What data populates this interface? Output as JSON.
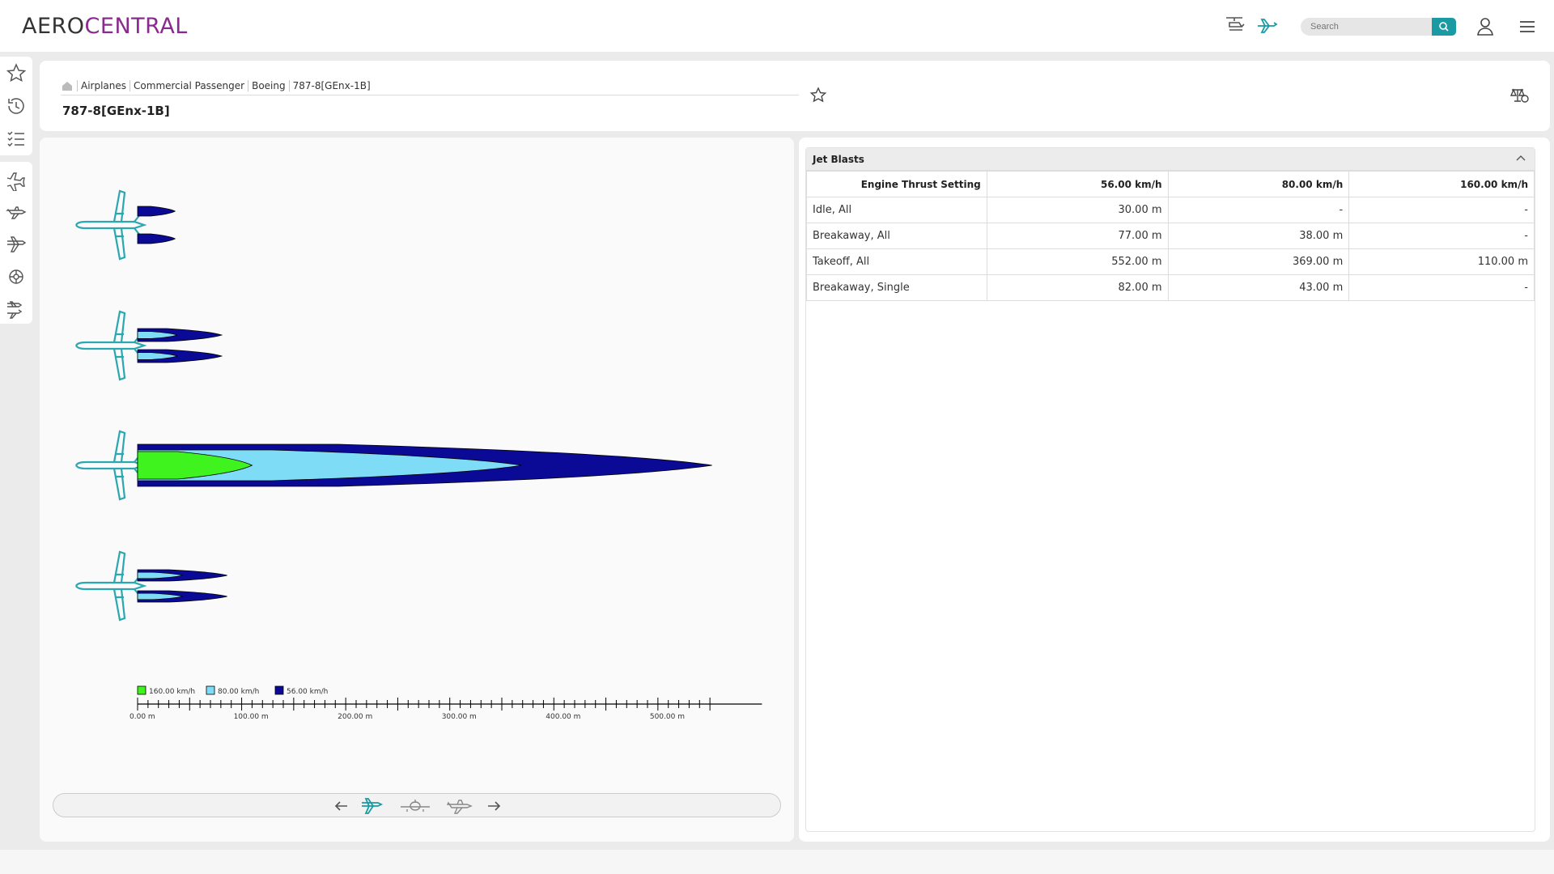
{
  "app": {
    "logo_part1": "AERO",
    "logo_part2": "CENTRAL"
  },
  "topbar": {
    "icons": [
      "helicopter-icon",
      "airplane-icon",
      "user-icon",
      "hamburger-menu-icon"
    ],
    "search": {
      "placeholder": "Search",
      "value": ""
    }
  },
  "sidebar": {
    "items": [
      "favorites-star-icon",
      "history-icon",
      "list-icon",
      "airplane-takeoff-icon",
      "airplane-side-icon",
      "airplane-top-icon",
      "engine-icon",
      "airplane-compare-icon"
    ]
  },
  "breadcrumb": [
    "Airplanes",
    "Commercial Passenger",
    "Boeing",
    "787-8[GEnx-1B]"
  ],
  "page": {
    "title": "787-8[GEnx-1B]"
  },
  "colors": {
    "accent": "#1a9aa3",
    "brand": "#8a2a8e",
    "v160": "#3ff31f",
    "v80": "#7edcf7",
    "v56": "#0a0a96"
  },
  "chart_data": {
    "type": "bar",
    "title": "",
    "xlabel": "",
    "ylabel": "",
    "categories": [
      "Idle, All",
      "Breakaway, All",
      "Takeoff, All",
      "Breakaway, Single"
    ],
    "series": [
      {
        "name": "160.00 km/h",
        "values": [
          null,
          null,
          110,
          null
        ]
      },
      {
        "name": "80.00 km/h",
        "values": [
          null,
          38,
          369,
          43
        ]
      },
      {
        "name": "56.00 km/h",
        "values": [
          30,
          77,
          552,
          82
        ]
      }
    ],
    "xlim": [
      0,
      560
    ],
    "xticks": [
      "0.00 m",
      "100.00 m",
      "200.00 m",
      "300.00 m",
      "400.00 m",
      "500.00 m"
    ],
    "legend": [
      "160.00 km/h",
      "80.00 km/h",
      "56.00 km/h"
    ],
    "legend_placement": "bottom-left",
    "orientation": "horizontal"
  },
  "diagram_nav": {
    "icons": [
      "arrow-left-icon",
      "airplane-top-view-icon",
      "airplane-front-view-icon",
      "airplane-side-view-icon",
      "arrow-right-icon"
    ]
  },
  "table": {
    "title": "Jet Blasts",
    "headers": [
      "Engine Thrust Setting",
      "56.00 km/h",
      "80.00 km/h",
      "160.00 km/h"
    ],
    "rows": [
      [
        "Idle, All",
        "30.00 m",
        "-",
        "-"
      ],
      [
        "Breakaway, All",
        "77.00 m",
        "38.00 m",
        "-"
      ],
      [
        "Takeoff, All",
        "552.00 m",
        "369.00 m",
        "110.00 m"
      ],
      [
        "Breakaway, Single",
        "82.00 m",
        "43.00 m",
        "-"
      ]
    ]
  }
}
